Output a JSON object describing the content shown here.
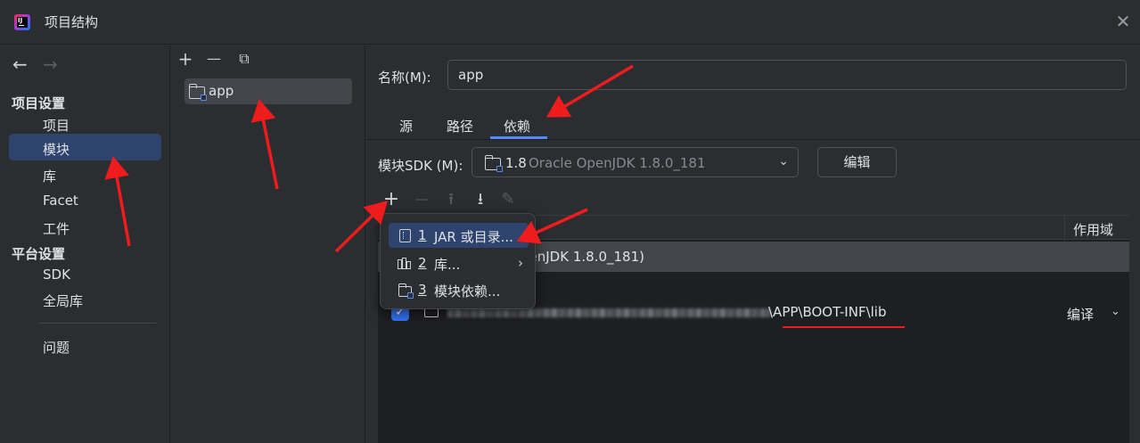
{
  "window": {
    "title": "项目结构",
    "close_glyph": "✕"
  },
  "left_nav": {
    "back_glyph": "←",
    "forward_glyph": "→",
    "project_settings_header": "项目设置",
    "project_settings_items": [
      "项目",
      "模块",
      "库",
      "Facet",
      "工件"
    ],
    "selected_item": "模块",
    "platform_settings_header": "平台设置",
    "platform_settings_items": [
      "SDK",
      "全局库"
    ],
    "problems": "问题"
  },
  "modules_panel": {
    "toolbar": {
      "add": "+",
      "remove": "—",
      "copy": "⧉"
    },
    "items": [
      "app"
    ]
  },
  "module_detail": {
    "name_label": "名称(M):",
    "name_value": "app",
    "tabs": [
      "源",
      "路径",
      "依赖"
    ],
    "active_tab": "依赖",
    "sdk_label": "模块SDK (M):",
    "sdk_version": "1.8",
    "sdk_description": "Oracle OpenJDK 1.8.0_181",
    "edit_button": "编辑",
    "dependency_toolbar": {
      "add": "+",
      "remove": "—",
      "move_up": "⭱",
      "move_down": "⭳",
      "edit": "✎"
    },
    "scope_column_header": "作用域",
    "dependencies": [
      {
        "visible_text": "penJDK 1.8.0_181)",
        "selected": true
      },
      {
        "path_suffix": "\\APP\\BOOT-INF\\lib",
        "checked": true,
        "scope": "编译"
      }
    ]
  },
  "add_dependency_popup": {
    "items": [
      {
        "number": "1",
        "label": "JAR 或目录...",
        "icon": "jar-icon",
        "selected": true
      },
      {
        "number": "2",
        "label": "库...",
        "icon": "library-icon",
        "submenu": "›"
      },
      {
        "number": "3",
        "label": "模块依赖...",
        "icon": "module-icon"
      }
    ]
  },
  "colors": {
    "background": "#2b2d30",
    "selection": "#2e436e",
    "accent": "#548af7",
    "annotation_red": "#ee1c1c"
  }
}
